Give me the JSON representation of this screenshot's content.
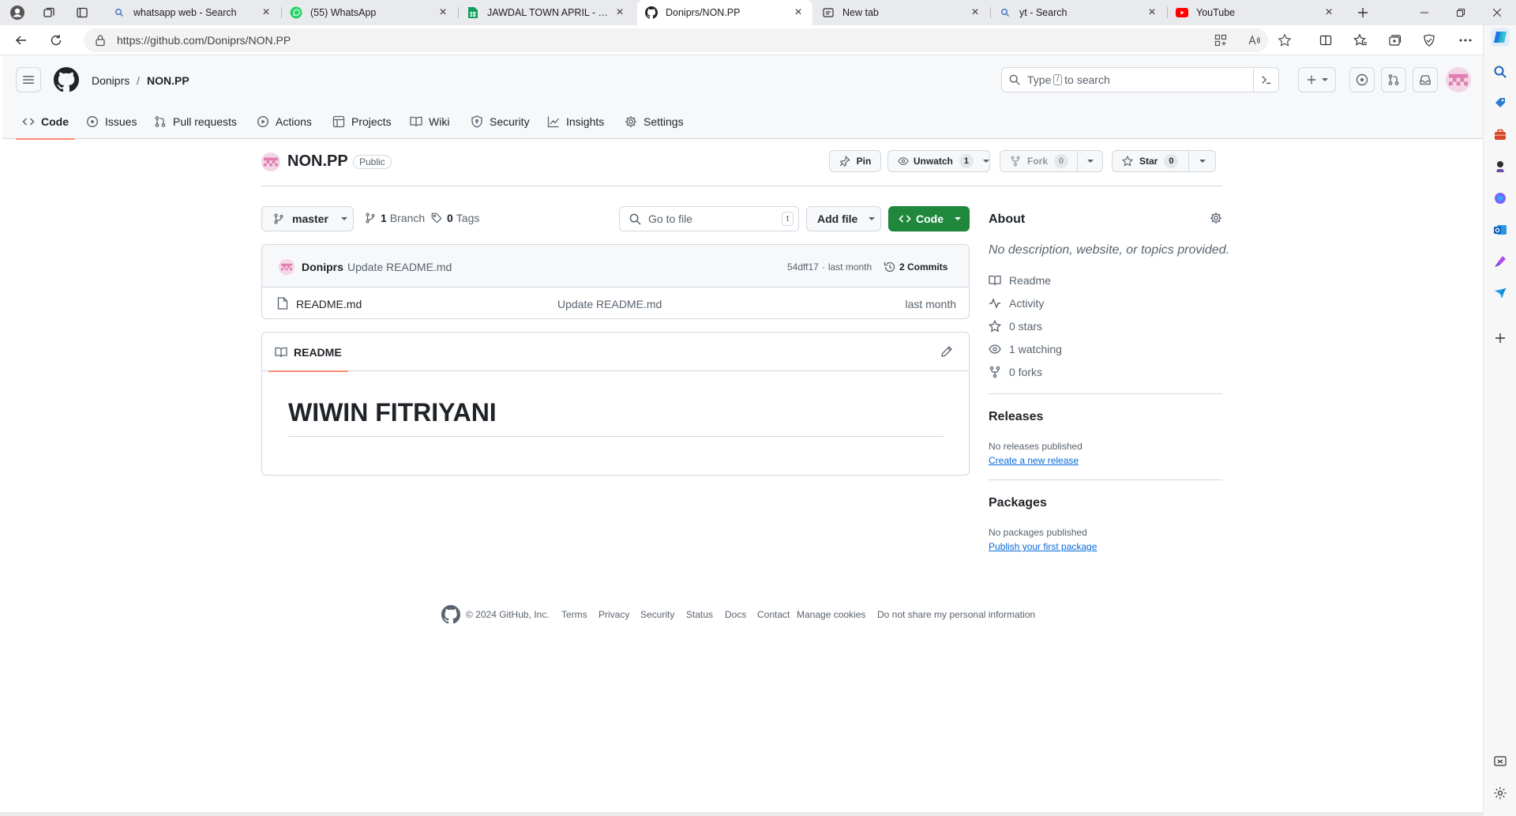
{
  "browser": {
    "tabs": [
      {
        "title": "whatsapp web - Search",
        "icon": "search-icon"
      },
      {
        "title": "(55) WhatsApp",
        "icon": "whatsapp-icon"
      },
      {
        "title": "JAWDAL TOWN APRIL - Googl",
        "icon": "sheets-icon"
      },
      {
        "title": "Doniprs/NON.PP",
        "icon": "github-icon",
        "active": true
      },
      {
        "title": "New tab",
        "icon": "newtab-icon"
      },
      {
        "title": "yt - Search",
        "icon": "search-icon"
      },
      {
        "title": "YouTube",
        "icon": "youtube-icon"
      }
    ],
    "url": "https://github.com/Doniprs/NON.PP"
  },
  "header": {
    "owner": "Doniprs",
    "separator": "/",
    "repo": "NON.PP",
    "search_prefix": "Type",
    "search_key": "/",
    "search_suffix": "to search"
  },
  "repo_nav": [
    {
      "label": "Code",
      "icon": "code-icon"
    },
    {
      "label": "Issues",
      "icon": "issue-icon"
    },
    {
      "label": "Pull requests",
      "icon": "pull-request-icon"
    },
    {
      "label": "Actions",
      "icon": "play-icon"
    },
    {
      "label": "Projects",
      "icon": "table-icon"
    },
    {
      "label": "Wiki",
      "icon": "book-icon"
    },
    {
      "label": "Security",
      "icon": "shield-icon"
    },
    {
      "label": "Insights",
      "icon": "graph-icon"
    },
    {
      "label": "Settings",
      "icon": "gear-icon"
    }
  ],
  "repo": {
    "name": "NON.PP",
    "visibility": "Public",
    "pin_label": "Pin",
    "unwatch_label": "Unwatch",
    "watch_count": "1",
    "fork_label": "Fork",
    "fork_count": "0",
    "star_label": "Star",
    "star_count": "0"
  },
  "toolbar": {
    "branch": "master",
    "branch_count": "1",
    "branch_label": "Branch",
    "tag_count": "0",
    "tag_label": "Tags",
    "goto_placeholder": "Go to file",
    "goto_key": "t",
    "add_file": "Add file",
    "code_button": "Code"
  },
  "commit": {
    "author": "Doniprs",
    "message": "Update README.md",
    "hash": "54dff17",
    "dot": "·",
    "time": "last month",
    "commits": "2 Commits"
  },
  "files": [
    {
      "name": "README.md",
      "message": "Update README.md",
      "time": "last month"
    }
  ],
  "readme": {
    "tab_label": "README",
    "heading": "WIWIN FITRIYANI"
  },
  "about": {
    "title": "About",
    "description": "No description, website, or topics provided.",
    "items": [
      {
        "label": "Readme",
        "icon": "book-icon"
      },
      {
        "label": "Activity",
        "icon": "pulse-icon"
      },
      {
        "label": "0 stars",
        "icon": "star-icon"
      },
      {
        "label": "1 watching",
        "icon": "eye-icon"
      },
      {
        "label": "0 forks",
        "icon": "fork-icon"
      }
    ]
  },
  "releases": {
    "title": "Releases",
    "empty": "No releases published",
    "link": "Create a new release"
  },
  "packages": {
    "title": "Packages",
    "empty": "No packages published",
    "link": "Publish your first package"
  },
  "footer": {
    "copyright": "© 2024 GitHub, Inc.",
    "links": [
      "Terms",
      "Privacy",
      "Security",
      "Status",
      "Docs",
      "Contact",
      "Manage cookies",
      "Do not share my personal information"
    ]
  },
  "colors": {
    "accent_green": "#1f883d",
    "link_blue": "#0969da",
    "tab_underline": "#fd8c73"
  }
}
